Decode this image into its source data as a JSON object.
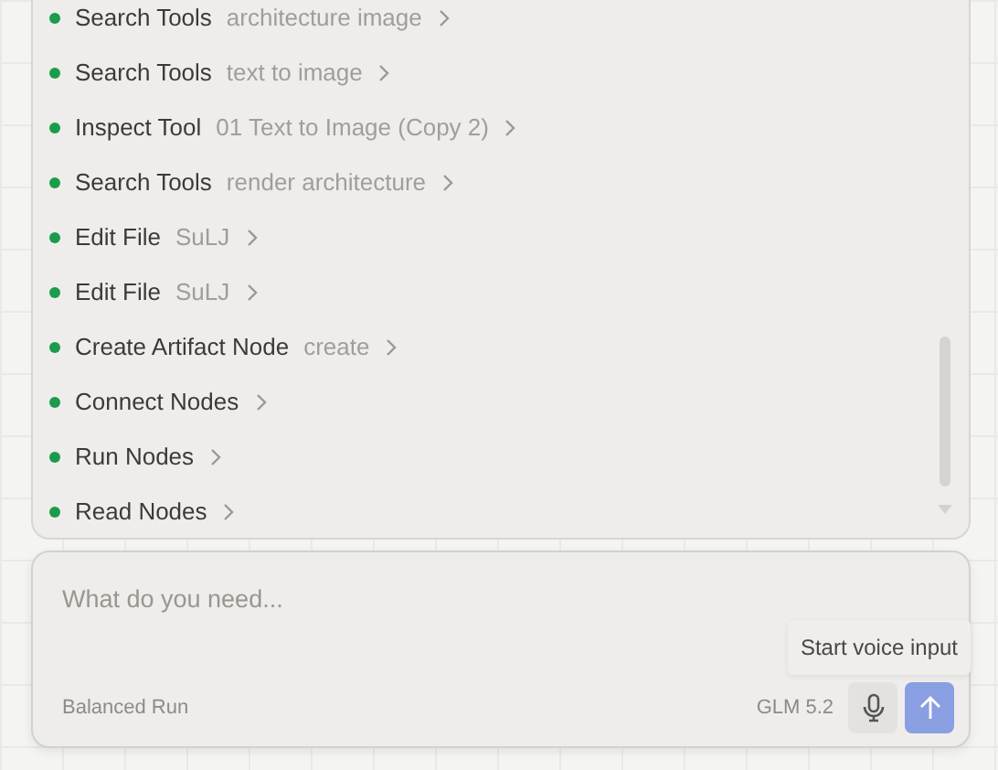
{
  "steps": [
    {
      "title": "Search Tools",
      "detail": "architecture image",
      "done": true
    },
    {
      "title": "Search Tools",
      "detail": "text to image",
      "done": true
    },
    {
      "title": "Inspect Tool",
      "detail": "01 Text to Image (Copy 2)",
      "done": true
    },
    {
      "title": "Search Tools",
      "detail": "render architecture",
      "done": true
    },
    {
      "title": "Edit File",
      "detail": "SuLJ",
      "done": true
    },
    {
      "title": "Edit File",
      "detail": "SuLJ",
      "done": true
    },
    {
      "title": "Create Artifact Node",
      "detail": "create",
      "done": true
    },
    {
      "title": "Connect Nodes",
      "done": true
    },
    {
      "title": "Run Nodes",
      "done": true
    },
    {
      "title": "Read Nodes",
      "done": true
    }
  ],
  "composer": {
    "placeholder": "What do you need...",
    "mode": "Balanced Run",
    "model": "GLM 5.2",
    "tooltip": "Start voice input"
  }
}
